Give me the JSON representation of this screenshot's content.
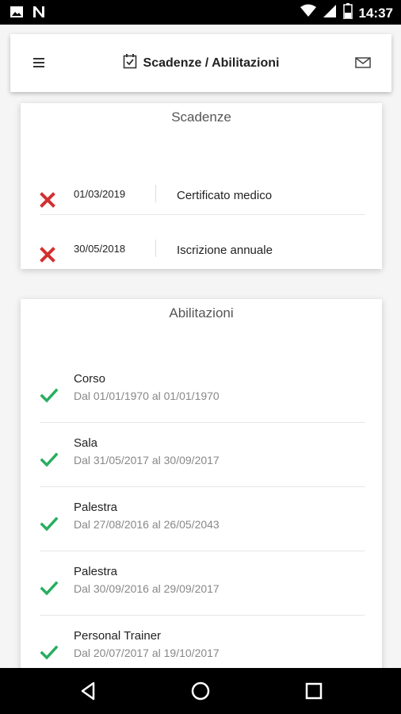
{
  "status_bar": {
    "time": "14:37",
    "left_icons": [
      "image-icon",
      "n-icon"
    ],
    "right_icons": [
      "wifi-icon",
      "signal-icon",
      "battery-icon"
    ]
  },
  "app_bar": {
    "title": "Scadenze / Abilitazioni",
    "menu_icon": "menu-icon",
    "title_icon": "calendar-check-icon",
    "mail_icon": "mail-icon"
  },
  "scadenze": {
    "title": "Scadenze",
    "items": [
      {
        "date": "01/03/2019",
        "label": "Certificato medico",
        "status": "expired"
      },
      {
        "date": "30/05/2018",
        "label": "Iscrizione annuale",
        "status": "expired"
      }
    ]
  },
  "abilitazioni": {
    "title": "Abilitazioni",
    "items": [
      {
        "name": "Corso",
        "range": "Dal 01/01/1970 al 01/01/1970",
        "status": "active"
      },
      {
        "name": "Sala",
        "range": "Dal 31/05/2017 al 30/09/2017",
        "status": "active"
      },
      {
        "name": "Palestra",
        "range": "Dal 27/08/2016 al 26/05/2043",
        "status": "active"
      },
      {
        "name": "Palestra",
        "range": "Dal 30/09/2016 al 29/09/2017",
        "status": "active"
      },
      {
        "name": "Personal Trainer",
        "range": "Dal 20/07/2017 al 19/10/2017",
        "status": "active"
      }
    ]
  },
  "colors": {
    "expired": "#d32f2f",
    "active": "#27ae60"
  },
  "nav_bar": {
    "buttons": [
      "back-icon",
      "home-icon",
      "recents-icon"
    ]
  }
}
